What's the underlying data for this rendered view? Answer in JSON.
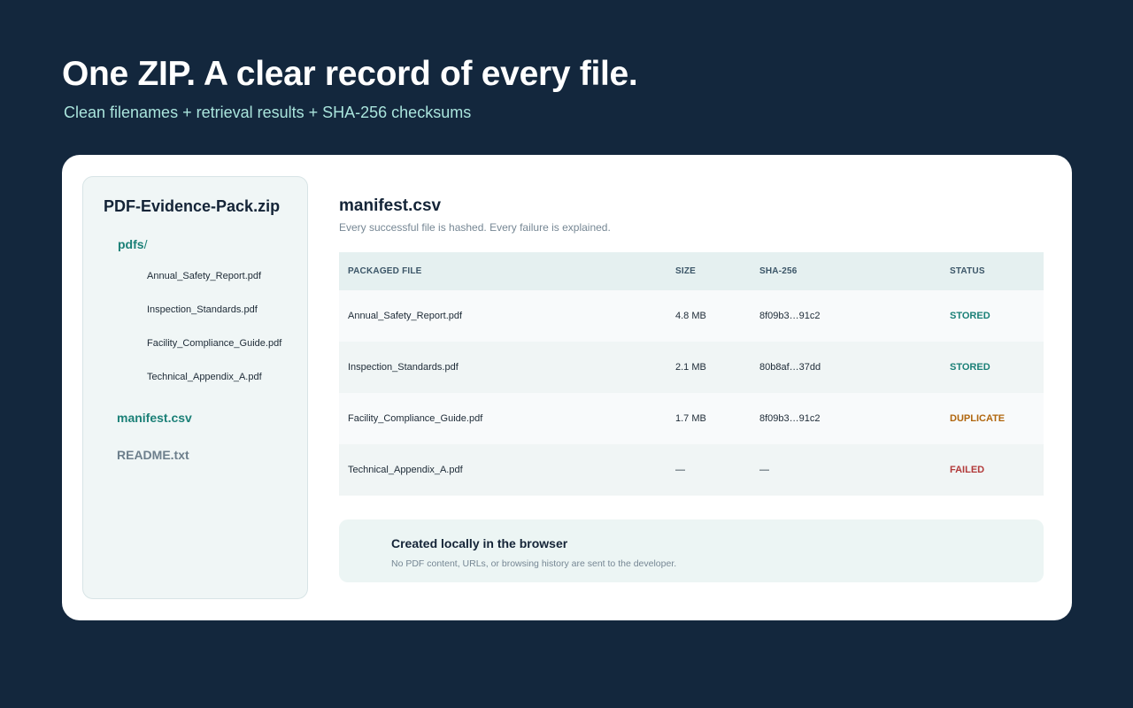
{
  "hero": {
    "title": "One ZIP. A clear record of every file.",
    "subtitle": "Clean filenames + retrieval results + SHA-256 checksums"
  },
  "tree": {
    "zip_name": "PDF-Evidence-Pack.zip",
    "folder_name": "pdfs",
    "folder_slash": "/",
    "files": [
      "Annual_Safety_Report.pdf",
      "Inspection_Standards.pdf",
      "Facility_Compliance_Guide.pdf",
      "Technical_Appendix_A.pdf"
    ],
    "manifest": "manifest.csv",
    "readme": "README.txt"
  },
  "manifest": {
    "title": "manifest.csv",
    "subtitle": "Every successful file is hashed. Every failure is explained.",
    "columns": [
      "PACKAGED FILE",
      "SIZE",
      "SHA-256",
      "STATUS"
    ],
    "rows": [
      {
        "file": "Annual_Safety_Report.pdf",
        "size": "4.8 MB",
        "hash": "8f09b3…91c2",
        "status": "STORED",
        "status_color": "#1b8077"
      },
      {
        "file": "Inspection_Standards.pdf",
        "size": "2.1 MB",
        "hash": "80b8af…37dd",
        "status": "STORED",
        "status_color": "#1b8077"
      },
      {
        "file": "Facility_Compliance_Guide.pdf",
        "size": "1.7 MB",
        "hash": "8f09b3…91c2",
        "status": "DUPLICATE",
        "status_color": "#b0660e"
      },
      {
        "file": "Technical_Appendix_A.pdf",
        "size": "—",
        "hash": "—",
        "status": "FAILED",
        "status_color": "#b23a3a"
      }
    ]
  },
  "note": {
    "title": "Created locally in the browser",
    "subtitle": "No PDF content, URLs, or browsing history are sent to the developer."
  },
  "colors": {
    "background": "#13273d",
    "accent": "#1b8077",
    "subtitle": "#a9e4dc"
  }
}
